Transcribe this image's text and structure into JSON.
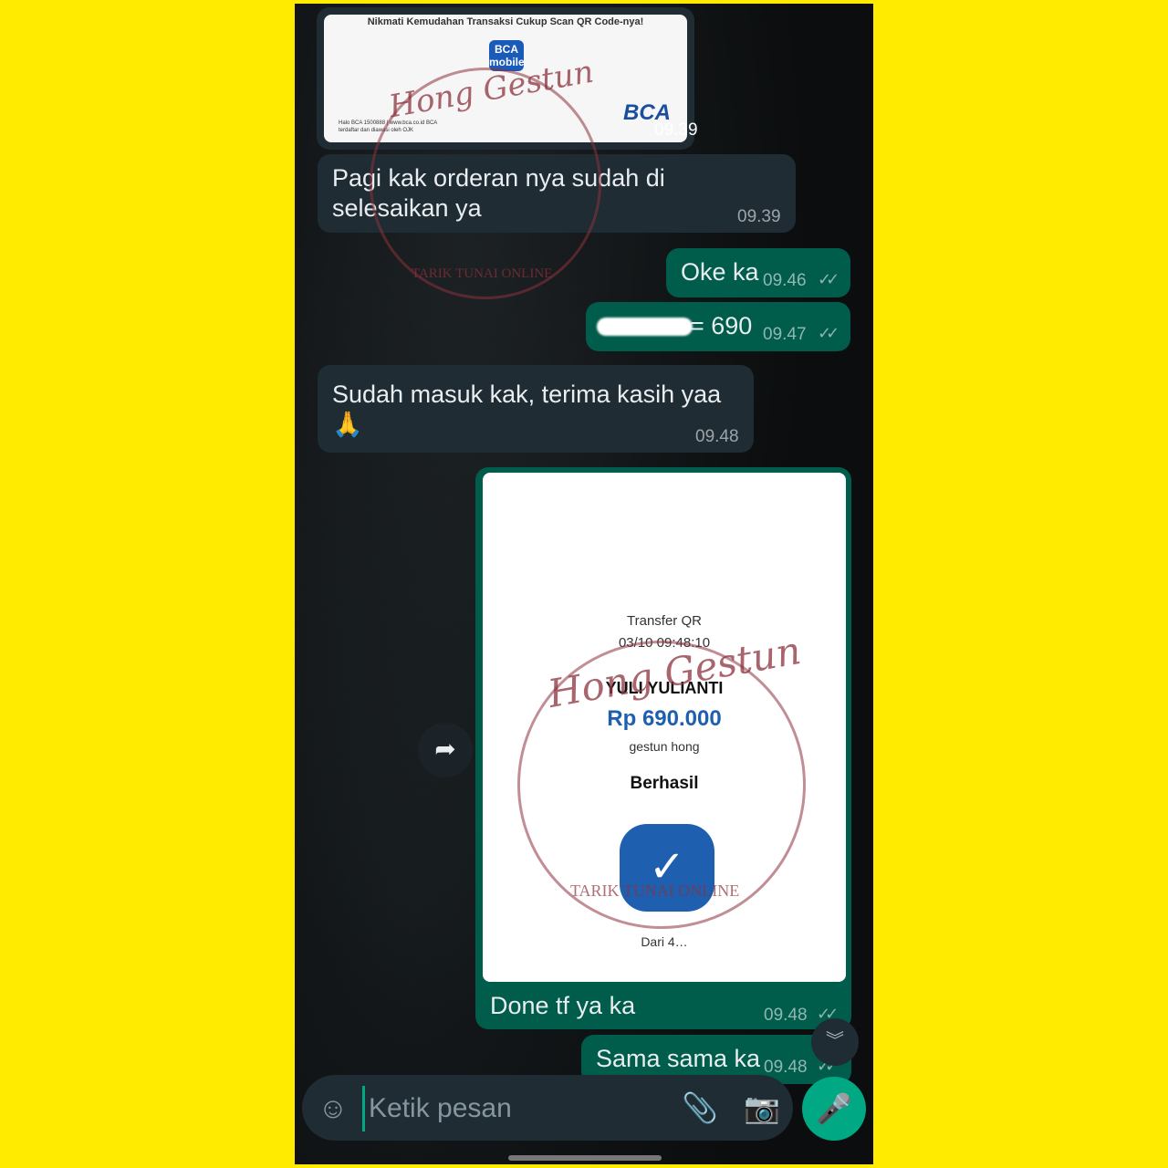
{
  "messages": {
    "m1": {
      "caption": "Nikmati Kemudahan Transaksi Cukup Scan QR Code-nya!",
      "badge": "BCA mobile",
      "logo": "BCA",
      "footer": "Halo BCA 1500888 | www.bca.co.id BCA terdaftar dan diawasi oleh OJK",
      "time": "09.39"
    },
    "m2": {
      "text": "Pagi kak orderan nya sudah di selesaikan ya",
      "time": "09.39"
    },
    "m3": {
      "text": "Oke ka",
      "time": "09.46",
      "ticks": "✓✓"
    },
    "m4": {
      "text": "= 690",
      "time": "09.47",
      "ticks": "✓✓"
    },
    "m5": {
      "text": "Sudah masuk kak, terima kasih yaa 🙏",
      "time": "09.48"
    },
    "m6": {
      "receipt": {
        "title": "Transfer QR",
        "datetime": "03/10 09:48:10",
        "name": "YULI YULIANTI",
        "amount": "Rp 690.000",
        "merchant": "gestun hong",
        "status": "Berhasil",
        "from": "Dari 4…"
      },
      "text": "Done tf ya ka",
      "time": "09.48",
      "ticks": "✓✓"
    },
    "m7": {
      "text": "Sama sama ka",
      "time": "09.48",
      "ticks": "✓✓"
    }
  },
  "watermark": {
    "script": "Hong Gestun",
    "arc": "TARIK TUNAI ONLINE"
  },
  "composer": {
    "placeholder": "Ketik pesan"
  },
  "icons": {
    "emoji": "emoji-icon",
    "attach": "paperclip-icon",
    "camera": "camera-icon",
    "mic": "mic-icon",
    "forward": "forward-icon",
    "scroll": "chevron-double-down-icon"
  }
}
